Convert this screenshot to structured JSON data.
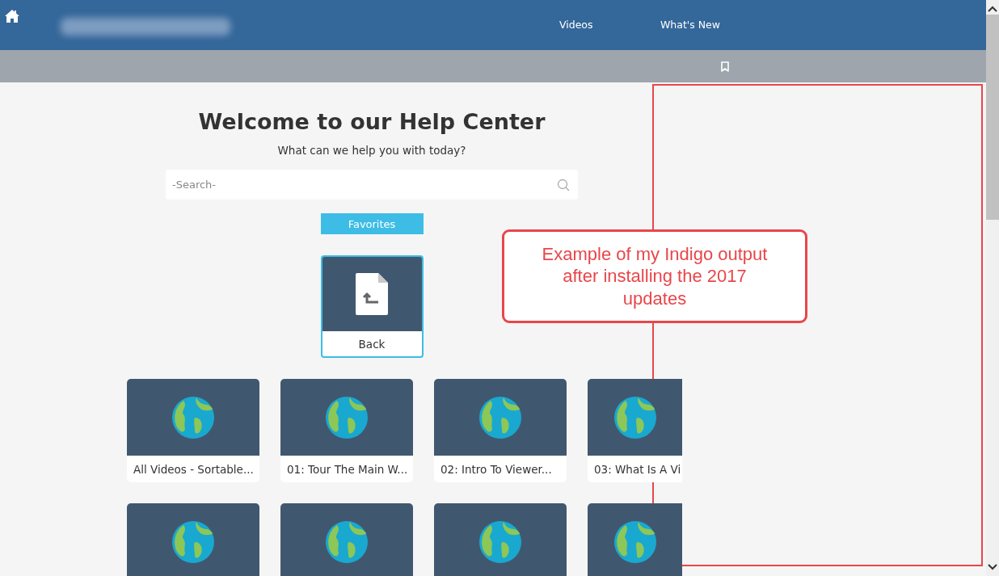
{
  "nav": {
    "links": [
      "Videos",
      "What's New"
    ]
  },
  "hero": {
    "title": "Welcome to our Help Center",
    "subtitle": "What can we help you with today?",
    "search": {
      "placeholder": "-Search-"
    },
    "favorites": "Favorites",
    "back": "Back"
  },
  "videos": [
    {
      "kind": "titled",
      "title": "All Videos - Sortable..."
    },
    {
      "kind": "titled",
      "title": "01: Tour The Main W..."
    },
    {
      "kind": "titled",
      "title": "02: Intro To Viewer..."
    },
    {
      "kind": "titled",
      "title": "03: What Is A Vi"
    },
    {
      "kind": "untitled"
    },
    {
      "kind": "untitled"
    },
    {
      "kind": "untitled"
    },
    {
      "kind": "untitled"
    }
  ],
  "annotation": {
    "text": "Example of my Indigo output after installing the 2017 updates"
  }
}
